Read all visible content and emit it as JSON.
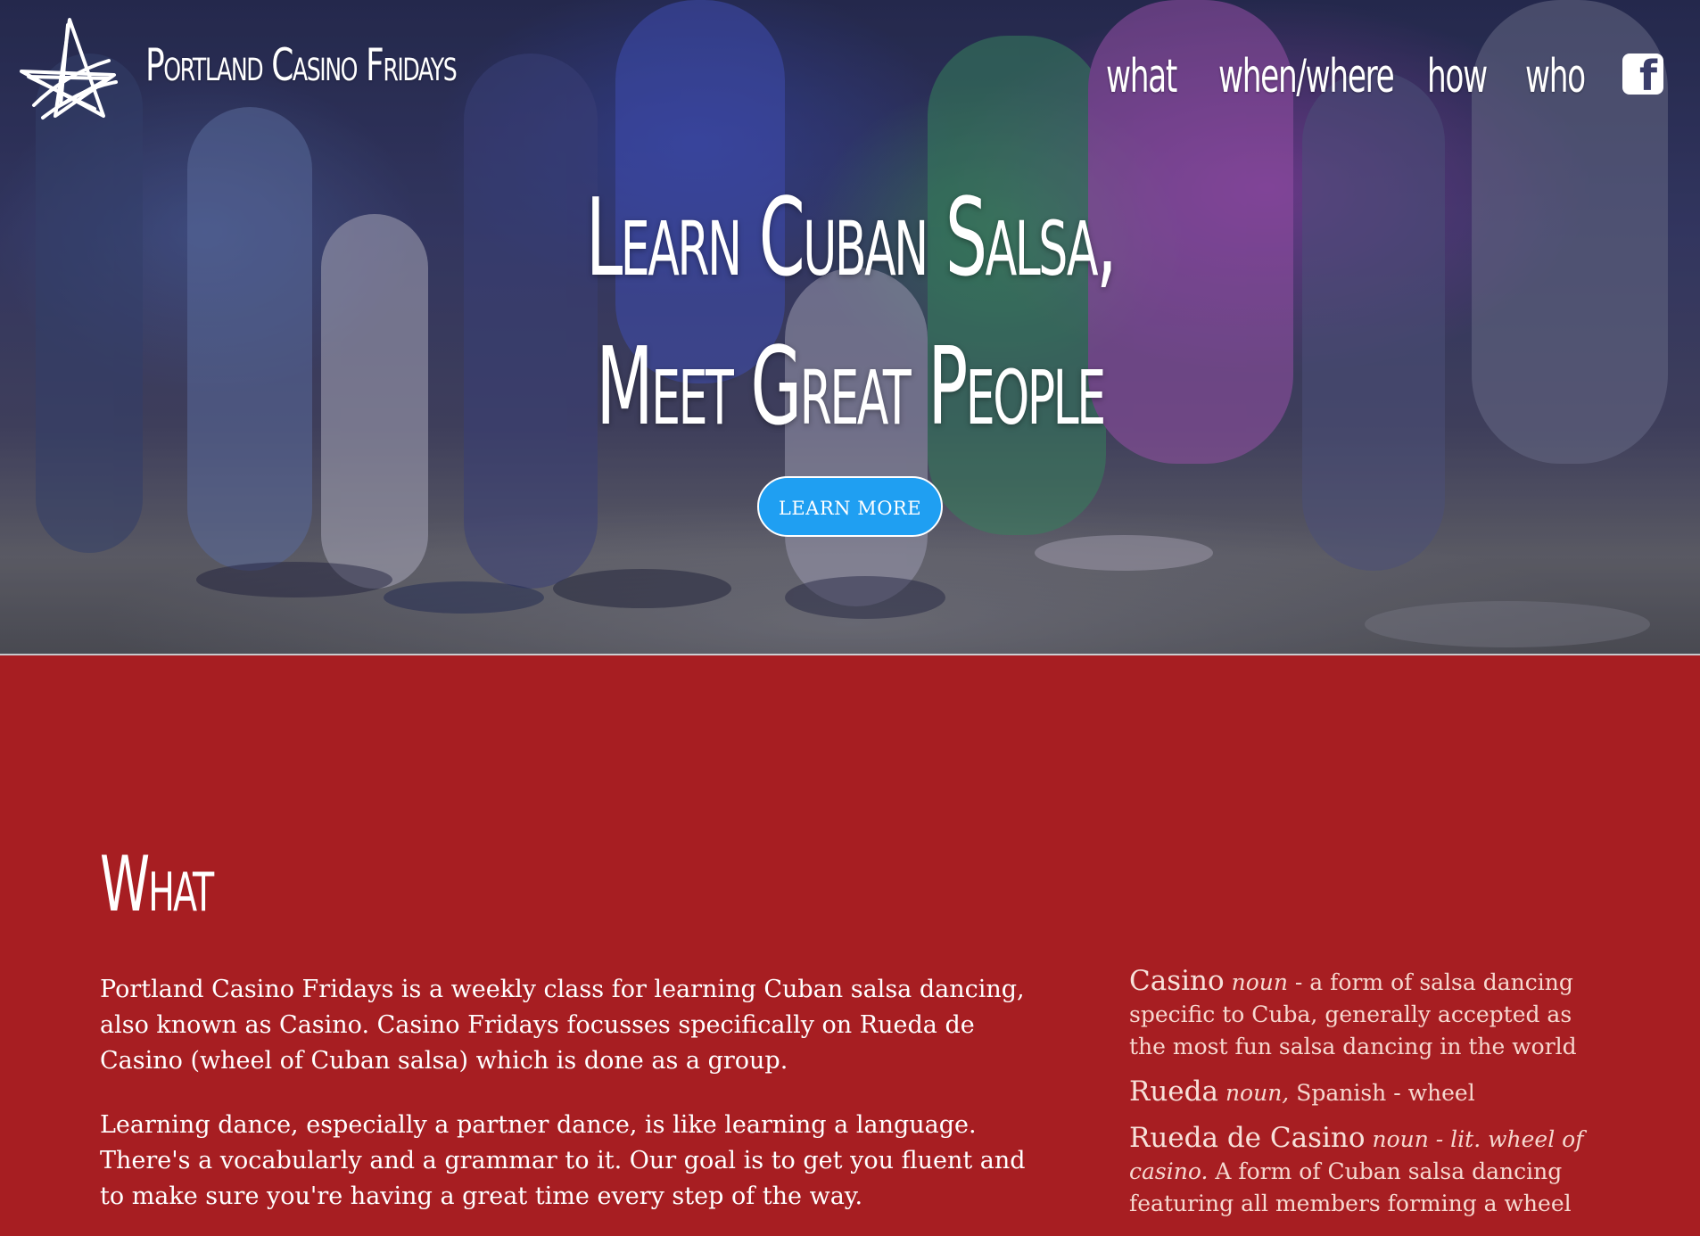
{
  "header": {
    "brand": "Portland Casino Fridays",
    "logo_icon": "star-scribble-logo",
    "nav": [
      {
        "label": "what"
      },
      {
        "label": "when/where"
      },
      {
        "label": "how"
      },
      {
        "label": "who"
      }
    ],
    "social_icon": "facebook-icon"
  },
  "hero": {
    "headline_line1": "Learn Cuban Salsa,",
    "headline_line2": "Meet Great People",
    "cta_label": "LEARN MORE"
  },
  "what": {
    "title": "What",
    "paragraph1": "Portland Casino Fridays is a weekly class for learning Cuban salsa dancing, also known as Casino. Casino Fridays focusses specifically on Rueda de Casino (wheel of Cuban salsa) which is done as a group.",
    "paragraph2": "Learning dance, especially a partner dance, is like learning a language. There's a vocabularly and a grammar to it. Our goal is to get you fluent and to make sure you're having a great time every step of the way.",
    "definitions": [
      {
        "term": "Casino",
        "pos": "noun",
        "text": " - a form of salsa dancing specific to Cuba, generally accepted as the most fun salsa dancing in the world"
      },
      {
        "term": "Rueda",
        "pos": "noun,",
        "text": " Spanish - wheel"
      },
      {
        "term": "Rueda de Casino",
        "pos": "noun",
        "lit": " - lit. wheel of casino.",
        "text": " A form of Cuban salsa dancing featuring all members forming a wheel"
      }
    ]
  }
}
